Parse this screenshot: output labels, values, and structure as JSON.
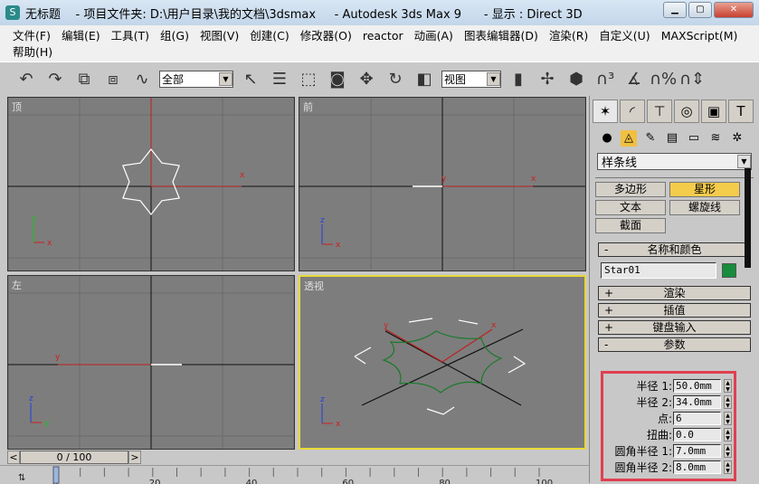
{
  "window": {
    "title": "无标题    - 项目文件夹: D:\\用户目录\\我的文档\\3dsmax     - Autodesk 3ds Max 9      - 显示 : Direct 3D",
    "controls": [
      "minimize",
      "maximize",
      "close"
    ]
  },
  "menu": [
    "文件(F)",
    "编辑(E)",
    "工具(T)",
    "组(G)",
    "视图(V)",
    "创建(C)",
    "修改器(O)",
    "reactor",
    "动画(A)",
    "图表编辑器(D)",
    "渲染(R)",
    "自定义(U)",
    "MAXScript(M)",
    "帮助(H)"
  ],
  "toolbar": {
    "selection_filter": "全部",
    "coord_system": "视图"
  },
  "viewports": [
    {
      "label": "顶",
      "active": false
    },
    {
      "label": "前",
      "active": false
    },
    {
      "label": "左",
      "active": false
    },
    {
      "label": "透视",
      "active": true
    }
  ],
  "axis": {
    "x": "x",
    "y": "y",
    "z": "z",
    "x_color": "#d02020",
    "y_color": "#20c020",
    "z_color": "#2040e0"
  },
  "panel": {
    "category": "样条线",
    "object_buttons": [
      "多边形",
      "星形",
      "文本",
      "螺旋线",
      "截面"
    ],
    "selected_button": "星形",
    "rollouts": {
      "name_color": "名称和颜色",
      "render": "渲染",
      "interp": "插值",
      "keyboard": "键盘输入",
      "params": "参数"
    },
    "object_name": "Star01",
    "object_color": "#168c3c",
    "params": [
      {
        "label": "半径 1:",
        "value": "50.0mm"
      },
      {
        "label": "半径 2:",
        "value": "34.0mm"
      },
      {
        "label": "点:",
        "value": "6"
      },
      {
        "label": "扭曲:",
        "value": "0.0"
      },
      {
        "label": "圆角半径 1:",
        "value": "7.0mm"
      },
      {
        "label": "圆角半径 2:",
        "value": "8.0mm"
      }
    ]
  },
  "timeline": {
    "frame": "0 / 100",
    "ticks": [
      "0",
      "20",
      "40",
      "60",
      "80",
      "100"
    ]
  }
}
